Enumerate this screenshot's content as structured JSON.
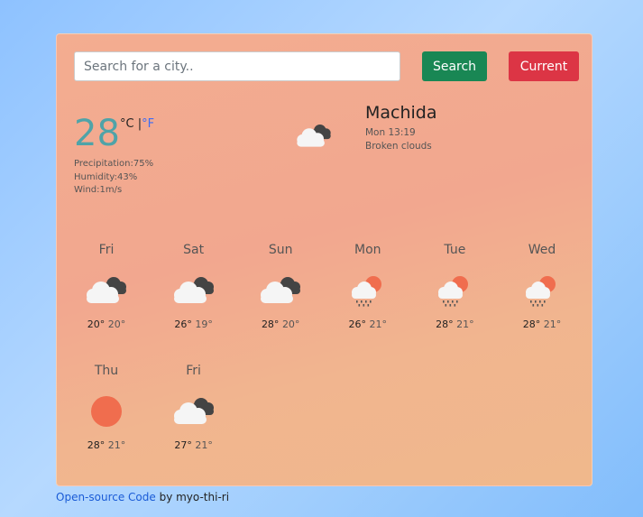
{
  "search": {
    "placeholder": "Search for a city..",
    "button": "Search"
  },
  "current_button": "Current",
  "current": {
    "temp": "28",
    "unit_c": "°C",
    "sep": "|",
    "unit_f": "°F",
    "precipitation": "Precipitation:75%",
    "humidity": "Humidity:43%",
    "wind": "Wind:1m/s",
    "icon": "broken-clouds-icon",
    "city": "Machida",
    "datetime": "Mon 13:19",
    "description": "Broken clouds"
  },
  "forecast": [
    {
      "day": "Fri",
      "icon": "broken-clouds-icon",
      "high": "20°",
      "low": "20°"
    },
    {
      "day": "Sat",
      "icon": "broken-clouds-icon",
      "high": "26°",
      "low": "19°"
    },
    {
      "day": "Sun",
      "icon": "broken-clouds-icon",
      "high": "28°",
      "low": "20°"
    },
    {
      "day": "Mon",
      "icon": "sun-rain-icon",
      "high": "26°",
      "low": "21°"
    },
    {
      "day": "Tue",
      "icon": "sun-rain-icon",
      "high": "28°",
      "low": "21°"
    },
    {
      "day": "Wed",
      "icon": "sun-rain-icon",
      "high": "28°",
      "low": "21°"
    },
    {
      "day": "Thu",
      "icon": "sun-icon",
      "high": "28°",
      "low": "21°"
    },
    {
      "day": "Fri",
      "icon": "broken-clouds-icon",
      "high": "27°",
      "low": "21°"
    }
  ],
  "footer": {
    "link": "Open-source Code",
    "text": " by myo-thi-ri"
  },
  "colors": {
    "search": "#198754",
    "current": "#dc3545",
    "temp": "#4fa3a8",
    "sun": "#f06d4e"
  }
}
